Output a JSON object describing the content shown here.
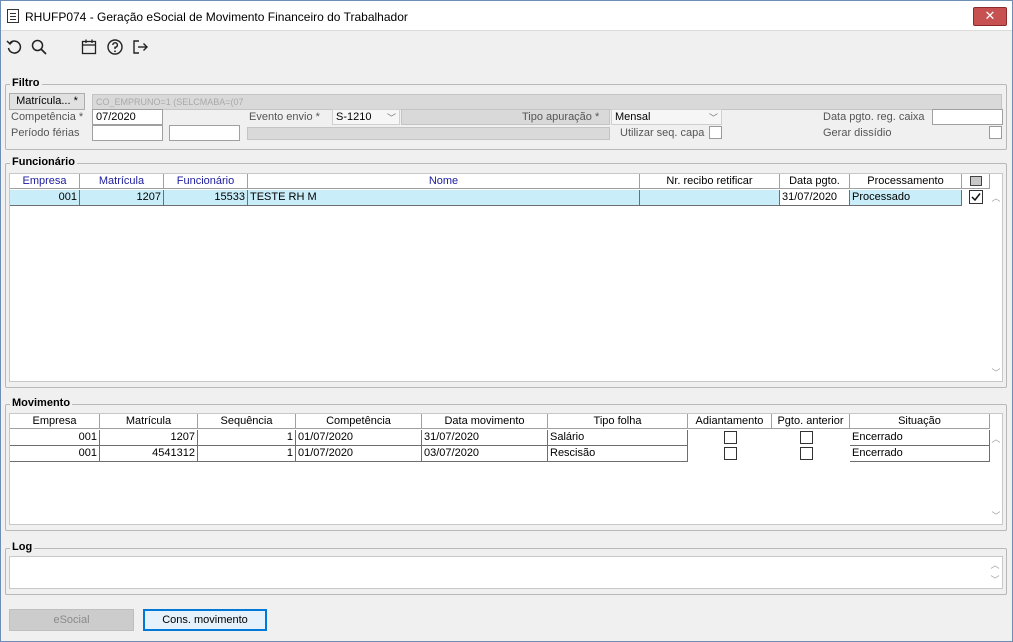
{
  "window": {
    "title": "RHUFP074 - Geração eSocial de Movimento Financeiro do Trabalhador",
    "close_glyph": "✕"
  },
  "toolbar": {
    "icons": [
      "undo-icon",
      "search-icon",
      "calendar-icon",
      "help-icon",
      "exit-icon"
    ]
  },
  "filtro": {
    "label": "Filtro",
    "matricula_button": "Matrícula... *",
    "matricula_value": "CO_EMPRUNO=1 (SELCMABA=(07",
    "competencia_label": "Competência *",
    "competencia_value": "07/2020",
    "evento_label": "Evento envio *",
    "evento_value": "S-1210",
    "tipo_label": "Tipo apuração *",
    "tipo_value": "Mensal",
    "data_pgto_label": "Data pgto. reg. caixa",
    "data_pgto_value": "",
    "periodo_label": "Período férias",
    "periodo_start": "",
    "periodo_end": "",
    "utilizar_label": "Utilizar seq. capa",
    "gerar_label": "Gerar dissídio"
  },
  "funcionario": {
    "label": "Funcionário",
    "columns": [
      "Empresa",
      "Matrícula",
      "Funcionário",
      "Nome",
      "Nr. recibo retificar",
      "Data pgto.",
      "Processamento"
    ],
    "rows": [
      {
        "empresa": "001",
        "matricula": "1207",
        "funcionario": "15533",
        "nome": "TESTE RH M",
        "recibo": "",
        "data_pgto": "31/07/2020",
        "processamento": "Processado",
        "checked": true
      }
    ]
  },
  "movimento": {
    "label": "Movimento",
    "columns": [
      "Empresa",
      "Matrícula",
      "Sequência",
      "Competência",
      "Data movimento",
      "Tipo folha",
      "Adiantamento",
      "Pgto. anterior",
      "Situação"
    ],
    "rows": [
      {
        "empresa": "001",
        "matricula": "1207",
        "sequencia": "1",
        "competencia": "01/07/2020",
        "data_movimento": "31/07/2020",
        "tipo_folha": "Salário",
        "situacao": "Encerrado"
      },
      {
        "empresa": "001",
        "matricula": "4541312",
        "sequencia": "1",
        "competencia": "01/07/2020",
        "data_movimento": "03/07/2020",
        "tipo_folha": "Rescisão",
        "situacao": "Encerrado"
      }
    ]
  },
  "log": {
    "label": "Log",
    "value": ""
  },
  "buttons": {
    "esocial": "eSocial",
    "cons_movimento": "Cons. movimento"
  },
  "colors": {
    "header_blue": "#1b1b9e",
    "selected_row": "#c9eef9",
    "close_red": "#c75050",
    "focus_blue": "#0078d7"
  }
}
